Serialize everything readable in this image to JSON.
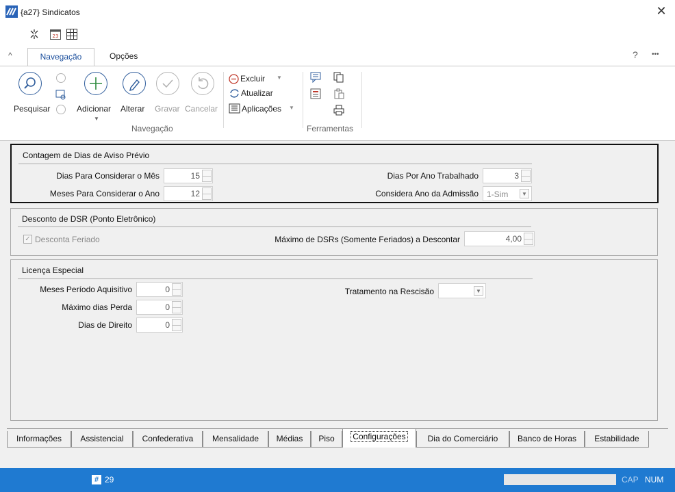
{
  "window": {
    "title": "{a27} Sindicatos",
    "close_label": "✕"
  },
  "ribbon": {
    "tabs": [
      {
        "label": "Navegação"
      },
      {
        "label": "Opções"
      }
    ],
    "help_label": "?",
    "more_label": "•••",
    "buttons": {
      "pesquisar": "Pesquisar",
      "adicionar": "Adicionar",
      "alterar": "Alterar",
      "gravar": "Gravar",
      "cancelar": "Cancelar",
      "excluir": "Excluir",
      "atualizar": "Atualizar",
      "aplicacoes": "Aplicações"
    },
    "groups": {
      "navegacao": "Navegação",
      "ferramentas": "Ferramentas"
    }
  },
  "aviso_previo": {
    "title": "Contagem de Dias de Aviso Prévio",
    "dias_mes_label": "Dias Para Considerar o Mês",
    "dias_mes_value": "15",
    "meses_ano_label": "Meses Para Considerar o Ano",
    "meses_ano_value": "12",
    "dias_ano_label": "Dias Por Ano Trabalhado",
    "dias_ano_value": "3",
    "ano_admissao_label": "Considera Ano da Admissão",
    "ano_admissao_value": "1-Sim"
  },
  "dsr": {
    "title": "Desconto de DSR (Ponto Eletrônico)",
    "desconta_feriado_label": "Desconta Feriado",
    "desconta_feriado_checked": true,
    "max_dsr_label": "Máximo de DSRs (Somente Feriados) a Descontar",
    "max_dsr_value": "4,00"
  },
  "licenca": {
    "title": "Licença Especial",
    "meses_periodo_label": "Meses Período Aquisitivo",
    "meses_periodo_value": "0",
    "max_perda_label": "Máximo dias Perda",
    "max_perda_value": "0",
    "dias_direito_label": "Dias de Direito",
    "dias_direito_value": "0",
    "tratamento_label": "Tratamento na Rescisão",
    "tratamento_value": ""
  },
  "bottom_tabs": [
    {
      "label": "Informações"
    },
    {
      "label": "Assistencial"
    },
    {
      "label": "Confederativa"
    },
    {
      "label": "Mensalidade"
    },
    {
      "label": "Médias"
    },
    {
      "label": "Piso"
    },
    {
      "label": "Configurações"
    },
    {
      "label": "Dia do Comerciário"
    },
    {
      "label": "Banco de Horas"
    },
    {
      "label": "Estabilidade"
    }
  ],
  "status": {
    "record_count": "29",
    "cap": "CAP",
    "num": "NUM"
  },
  "colors": {
    "accent": "#1f7ad1",
    "tab_text": "#1a4e9c",
    "highlight_border": "#111111"
  }
}
